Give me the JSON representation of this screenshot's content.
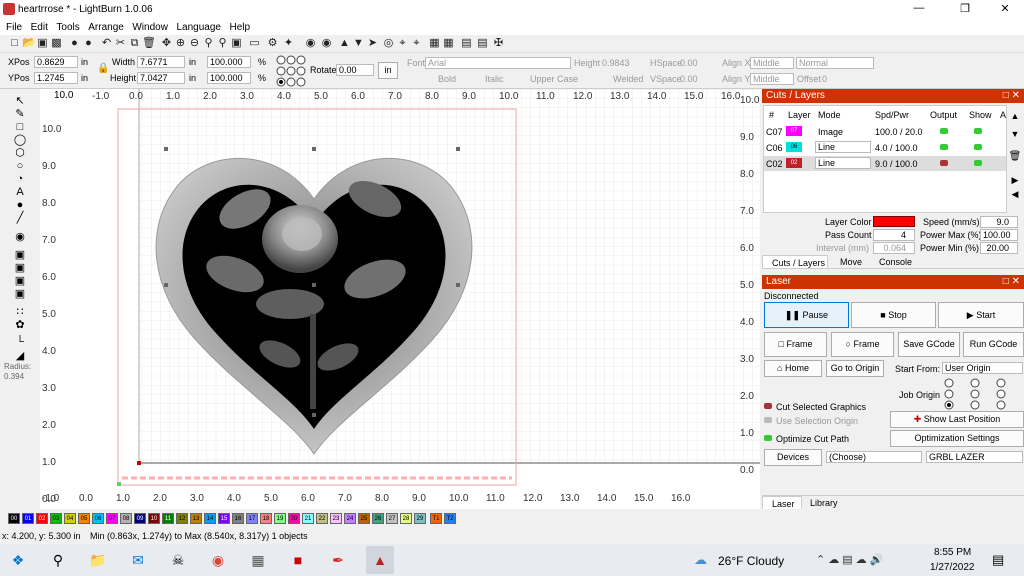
{
  "window": {
    "title": "heartrrose * - LightBurn 1.0.06"
  },
  "menu": [
    "File",
    "Edit",
    "Tools",
    "Arrange",
    "Window",
    "Language",
    "Help"
  ],
  "props": {
    "xpos_label": "XPos",
    "xpos_value": "0.8629",
    "xpos_unit": "in",
    "ypos_label": "YPos",
    "ypos_value": "1.2745",
    "ypos_unit": "in",
    "width_label": "Width",
    "width_value": "7.6771",
    "width_unit": "in",
    "height_label": "Height",
    "height_value": "7.0427",
    "height_unit": "in",
    "scale_w": "100.000",
    "scale_h": "100.000",
    "pct": "%",
    "rotate_label": "Rotate",
    "rotate_value": "0.00",
    "rotate_unit": "in",
    "font_label": "Font",
    "font_value": "Arial",
    "text_height_label": "Height",
    "text_height_value": "0.9843",
    "hspace_label": "HSpace",
    "hspace_value": "0.00",
    "vspace_label": "VSpace",
    "vspace_value": "0.00",
    "alignx_label": "Align X",
    "alignx_value": "Middle",
    "aligny_label": "Align Y",
    "aligny_value": "Middle",
    "normal": "Normal",
    "offset_label": "Offset",
    "offset_value": "0",
    "bold": "Bold",
    "italic": "Italic",
    "uppercase": "Upper Case",
    "welded": "Welded"
  },
  "canvas": {
    "ruler_top": [
      "-1.0",
      "0.0",
      "1.0",
      "2.0",
      "3.0",
      "4.0",
      "5.0",
      "6.0",
      "7.0",
      "8.0",
      "9.0",
      "10.0",
      "11.0",
      "12.0",
      "13.0",
      "14.0",
      "15.0",
      "16.0"
    ],
    "ruler_bottom": [
      "-1.0",
      "0.0",
      "1.0",
      "2.0",
      "3.0",
      "4.0",
      "5.0",
      "6.0",
      "7.0",
      "8.0",
      "9.0",
      "10.0",
      "11.0",
      "12.0",
      "13.0",
      "14.0",
      "15.0",
      "16.0"
    ],
    "ruler_left": [
      "10.0",
      "9.0",
      "8.0",
      "7.0",
      "6.0",
      "5.0",
      "4.0",
      "3.0",
      "2.0",
      "1.0",
      "0.0"
    ],
    "ruler_right": [
      "10.0",
      "9.0",
      "8.0",
      "7.0",
      "6.0",
      "5.0",
      "4.0",
      "3.0",
      "2.0",
      "1.0",
      "0.0"
    ],
    "corner_label": "10.0"
  },
  "left": {
    "radius_label": "Radius:",
    "radius_value": "0.394"
  },
  "cuts": {
    "title": "Cuts / Layers",
    "headers": [
      "#",
      "Layer",
      "Mode",
      "Spd/Pwr",
      "Output",
      "Show",
      "A"
    ],
    "rows": [
      {
        "num": "C07",
        "layer": "07",
        "color": "#ff00ff",
        "mode": "Image",
        "spd": "100.0 / 20.0"
      },
      {
        "num": "C06",
        "layer": "06",
        "color": "#00e0e0",
        "mode": "Line",
        "spd": "4.0 / 100.0"
      },
      {
        "num": "C02",
        "layer": "02",
        "color": "#c0202a",
        "mode": "Line",
        "spd": "9.0 / 100.0"
      }
    ],
    "layer_color_label": "Layer Color",
    "layer_color": "#ff0000",
    "speed_label": "Speed (mm/s)",
    "speed_value": "9.0",
    "pass_label": "Pass Count",
    "pass_value": "4",
    "pmax_label": "Power Max (%)",
    "pmax_value": "100.00",
    "interval_label": "Interval (mm)",
    "interval_value": "0.064",
    "pmin_label": "Power Min (%)",
    "pmin_value": "20.00",
    "tabs": [
      "Cuts / Layers",
      "Move",
      "Console"
    ]
  },
  "laser": {
    "title": "Laser",
    "status": "Disconnected",
    "pause": "Pause",
    "stop": "Stop",
    "start": "Start",
    "frame1": "Frame",
    "frame2": "Frame",
    "save_gcode": "Save GCode",
    "run_gcode": "Run GCode",
    "home": "Home",
    "goto_origin": "Go to Origin",
    "start_from_label": "Start From:",
    "start_from_value": "User Origin",
    "job_origin_label": "Job Origin",
    "cut_selected": "Cut Selected Graphics",
    "use_selection": "Use Selection Origin",
    "show_last": "Show Last Position",
    "optimize_cut": "Optimize Cut Path",
    "opt_settings": "Optimization Settings",
    "devices": "Devices",
    "choose": "(Choose)",
    "grbl": "GRBL LAZER",
    "tabs": [
      "Laser",
      "Library"
    ]
  },
  "palette": [
    "00",
    "01",
    "02",
    "03",
    "04",
    "05",
    "06",
    "07",
    "08",
    "09",
    "10",
    "11",
    "12",
    "13",
    "14",
    "15",
    "16",
    "17",
    "18",
    "19",
    "20",
    "21",
    "22",
    "23",
    "24",
    "25",
    "26",
    "27",
    "28",
    "29",
    "T1",
    "T2"
  ],
  "palette_colors": [
    "#000000",
    "#0000ff",
    "#ff0000",
    "#00c000",
    "#d0d000",
    "#ff8000",
    "#00c0ff",
    "#ff00ff",
    "#b0b0b0",
    "#000080",
    "#800000",
    "#008000",
    "#808000",
    "#c08000",
    "#00a0ff",
    "#8000ff",
    "#808080",
    "#8080ff",
    "#ff8080",
    "#80ff80",
    "#ff00aa",
    "#80ffff",
    "#c0c080",
    "#ffc0ff",
    "#c080ff",
    "#c06000",
    "#40a080",
    "#c0c0c0",
    "#e0ff80",
    "#80c0c0",
    "#ff6000",
    "#2080ff"
  ],
  "status": {
    "coords": "x: 4.200, y: 5.300 in",
    "bounds": "Min (0.863x, 1.274y) to Max (8.540x, 8.317y)  1 objects"
  },
  "taskbar": {
    "weather": "26°F  Cloudy",
    "time": "8:55 PM",
    "date": "1/27/2022"
  }
}
